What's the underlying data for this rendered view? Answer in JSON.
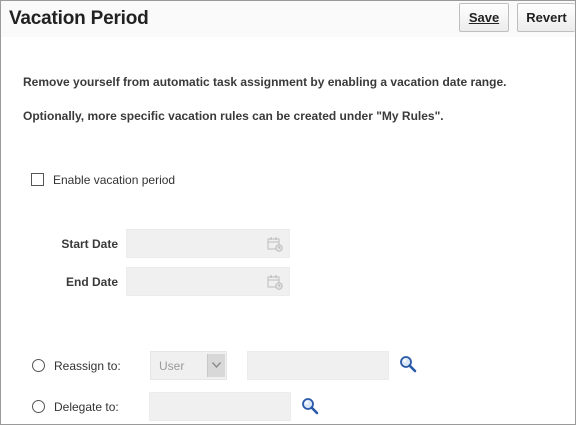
{
  "header": {
    "title": "Vacation Period",
    "save_label": "Save",
    "revert_label": "Revert"
  },
  "description": {
    "line1": "Remove yourself from automatic task assignment by enabling a vacation date range.",
    "line2": "Optionally, more specific vacation rules can be created under \"My Rules\"."
  },
  "enable_vacation": {
    "label": "Enable vacation period",
    "checked": false
  },
  "dates": {
    "start_label": "Start Date",
    "start_value": "",
    "end_label": "End Date",
    "end_value": "",
    "icon": "calendar-icon"
  },
  "reassign": {
    "label": "Reassign to:",
    "type_selected": "User",
    "value": "",
    "icon": "search-icon"
  },
  "delegate": {
    "label": "Delegate to:",
    "value": "",
    "icon": "search-icon"
  },
  "colors": {
    "disabled_field": "#f0f0f0",
    "search_icon": "#2a5aa8"
  }
}
